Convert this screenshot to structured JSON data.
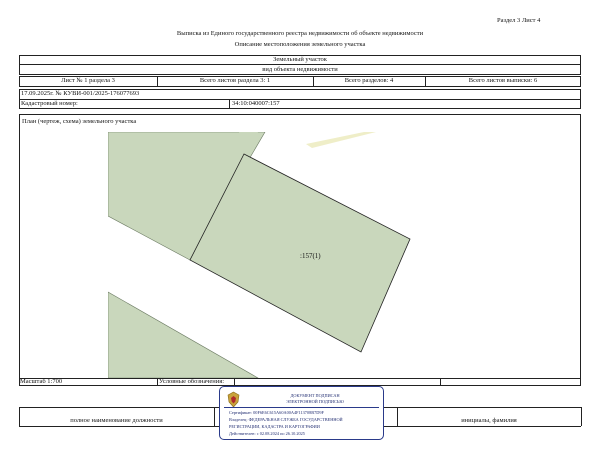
{
  "header": {
    "section_sheet": "Раздел 3   Лист 4",
    "title": "Выписка из Единого государственного реестра недвижимости об объекте недвижимости",
    "subtitle": "Описание местоположения земельного участка"
  },
  "object": {
    "name": "Земельный участок",
    "kind": "вид объекта недвижимости"
  },
  "counts": {
    "sheet": "Лист № 1 раздела 3",
    "total_sheets_section": "Всего листов раздела 3: 1",
    "total_sections": "Всего разделов: 4",
    "total_sheets_extract": "Всего листов выписки: 6"
  },
  "record": {
    "date_number": "17.09.2025г. № КУВИ-001/2025-176077693",
    "cadastral_label": "Кадастровый номер:",
    "cadastral_value": "34:10:040007:157"
  },
  "plan": {
    "caption": "План (чертеж, схема) земельного участка",
    "parcel_label": ":157(1)"
  },
  "footer": {
    "scale": "Масштаб 1:700",
    "legend_label": "Условные обозначения:",
    "position_label": "полное наименование должности",
    "initials_label": "инициалы, фамилия"
  },
  "stamp": {
    "line1": "ДОКУМЕНТ ПОДПИСАН",
    "line2": "ЭЛЕКТРОННОЙ ПОДПИСЬЮ",
    "line3": "Сертификат: 00F6E6C615A60A00A4F113708B7D9F",
    "line4": "Владелец: ФЕДЕРАЛЬНАЯ СЛУЖБА ГОСУДАРСТВЕННОЙ",
    "line5": "РЕГИСТРАЦИИ, КАДАСТРА И КАРТОГРАФИИ",
    "line6": "Действителен: с 02.08.2024 по 26.10.2025"
  },
  "colors": {
    "parcel_fill": "#c9d7bc",
    "road_fill": "#efeec8",
    "stamp_border": "#2a3a8a"
  }
}
